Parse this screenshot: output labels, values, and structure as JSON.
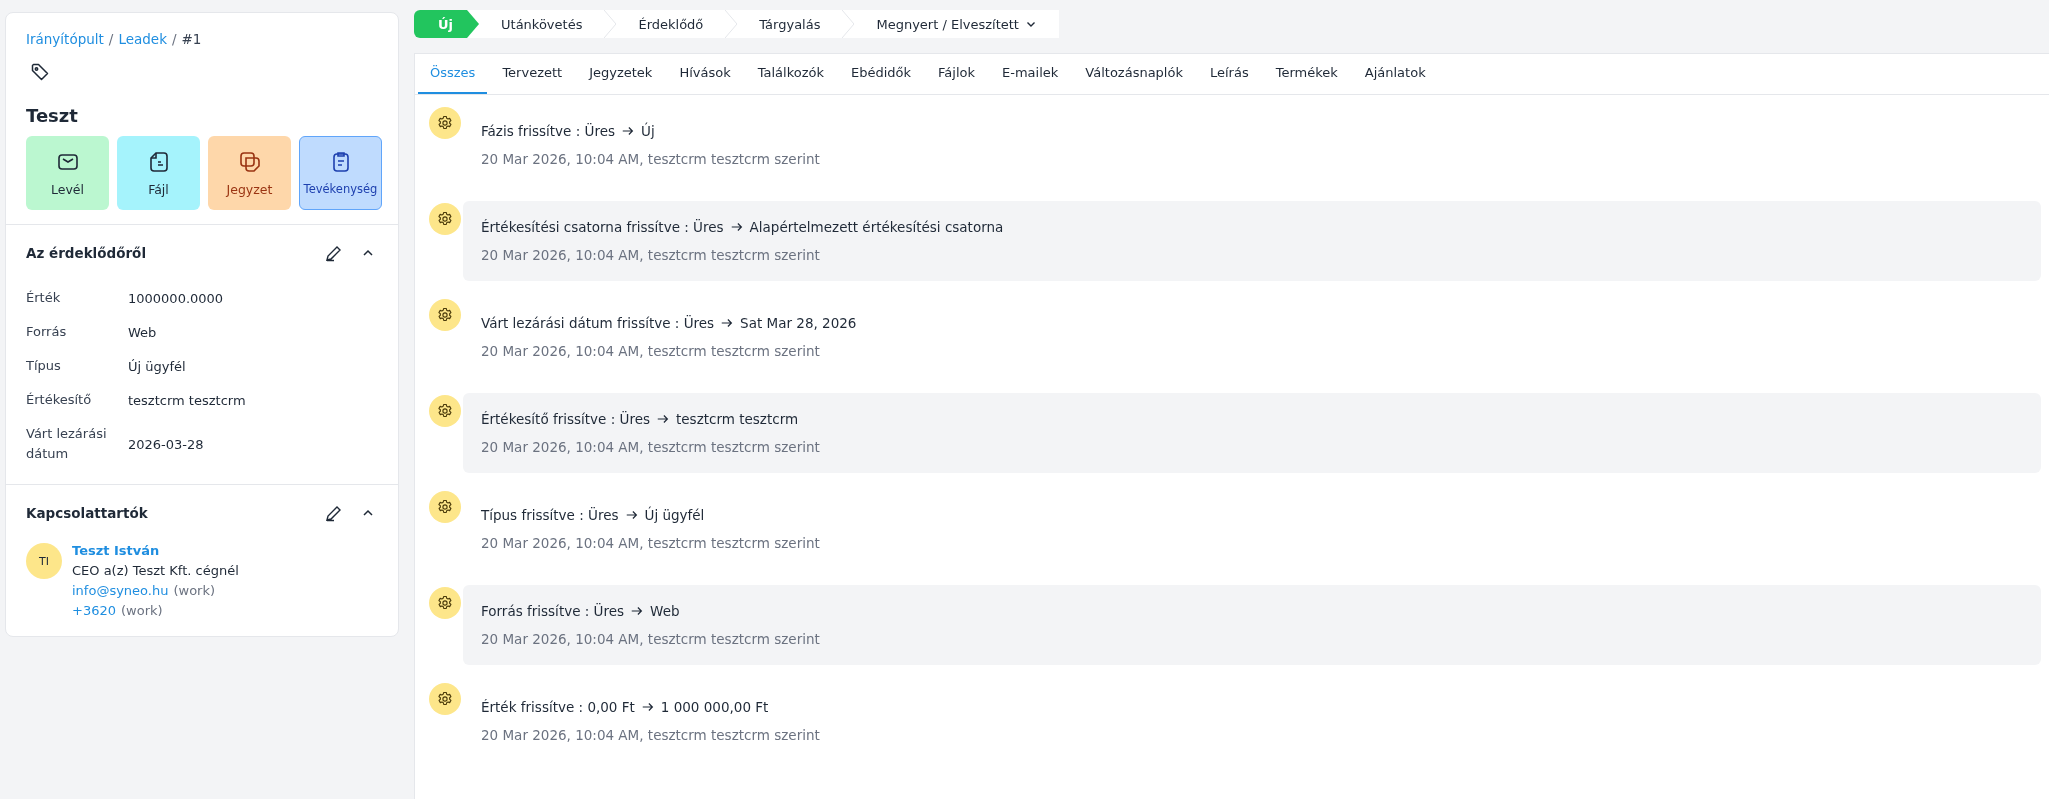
{
  "breadcrumb": {
    "links": [
      "Irányítópult",
      "Leadek"
    ],
    "separator": "/",
    "current": "#1"
  },
  "lead": {
    "title": "Teszt"
  },
  "actions": [
    {
      "label": "Levél",
      "kind": "mail",
      "selected": false
    },
    {
      "label": "Fájl",
      "kind": "file",
      "selected": false
    },
    {
      "label": "Jegyzet",
      "kind": "note",
      "selected": false
    },
    {
      "label": "Tevékenység",
      "kind": "activity",
      "selected": true
    }
  ],
  "about": {
    "title": "Az érdeklődőről",
    "fields": [
      {
        "label": "Érték",
        "value": "1000000.0000"
      },
      {
        "label": "Forrás",
        "value": "Web"
      },
      {
        "label": "Típus",
        "value": "Új ügyfél"
      },
      {
        "label": "Értékesítő",
        "value": "tesztcrm tesztcrm"
      },
      {
        "label": "Várt lezárási dátum",
        "value": "2026-03-28"
      }
    ]
  },
  "contacts": {
    "title": "Kapcsolattartók",
    "items": [
      {
        "initials": "TI",
        "name": "Teszt István",
        "role": "CEO a(z) Teszt Kft. cégnél",
        "email": "info@syneo.hu",
        "email_type": "(work)",
        "phone": "+3620",
        "phone_type": "(work)"
      }
    ]
  },
  "stages": [
    {
      "label": "Új",
      "selected": true
    },
    {
      "label": "Utánkövetés",
      "selected": false
    },
    {
      "label": "Érdeklődő",
      "selected": false
    },
    {
      "label": "Tárgyalás",
      "selected": false
    },
    {
      "label": "Megnyert / Elveszített",
      "selected": false,
      "dropdown": true
    }
  ],
  "tabs": [
    {
      "label": "Összes",
      "selected": true
    },
    {
      "label": "Tervezett",
      "selected": false
    },
    {
      "label": "Jegyzetek",
      "selected": false
    },
    {
      "label": "Hívások",
      "selected": false
    },
    {
      "label": "Találkozók",
      "selected": false
    },
    {
      "label": "Ebédidők",
      "selected": false
    },
    {
      "label": "Fájlok",
      "selected": false
    },
    {
      "label": "E-mailek",
      "selected": false
    },
    {
      "label": "Változásnaplók",
      "selected": false
    },
    {
      "label": "Leírás",
      "selected": false
    },
    {
      "label": "Termékek",
      "selected": false
    },
    {
      "label": "Ajánlatok",
      "selected": false
    }
  ],
  "timeline": [
    {
      "change": "Fázis frissítve : Üres",
      "new_value": "Új",
      "meta": "20 Mar 2026, 10:04 AM, tesztcrm tesztcrm szerint",
      "highlighted": false
    },
    {
      "change": "Értékesítési csatorna frissítve : Üres",
      "new_value": "Alapértelmezett értékesítési csatorna",
      "meta": "20 Mar 2026, 10:04 AM, tesztcrm tesztcrm szerint",
      "highlighted": true
    },
    {
      "change": "Várt lezárási dátum frissítve : Üres",
      "new_value": "Sat Mar 28, 2026",
      "meta": "20 Mar 2026, 10:04 AM, tesztcrm tesztcrm szerint",
      "highlighted": false
    },
    {
      "change": "Értékesítő frissítve : Üres",
      "new_value": "tesztcrm tesztcrm",
      "meta": "20 Mar 2026, 10:04 AM, tesztcrm tesztcrm szerint",
      "highlighted": true
    },
    {
      "change": "Típus frissítve : Üres",
      "new_value": "Új ügyfél",
      "meta": "20 Mar 2026, 10:04 AM, tesztcrm tesztcrm szerint",
      "highlighted": false
    },
    {
      "change": "Forrás frissítve : Üres",
      "new_value": "Web",
      "meta": "20 Mar 2026, 10:04 AM, tesztcrm tesztcrm szerint",
      "highlighted": true
    },
    {
      "change": "Érték frissítve : 0,00 Ft",
      "new_value": "1 000 000,00 Ft",
      "meta": "20 Mar 2026, 10:04 AM, tesztcrm tesztcrm szerint",
      "highlighted": false
    }
  ]
}
